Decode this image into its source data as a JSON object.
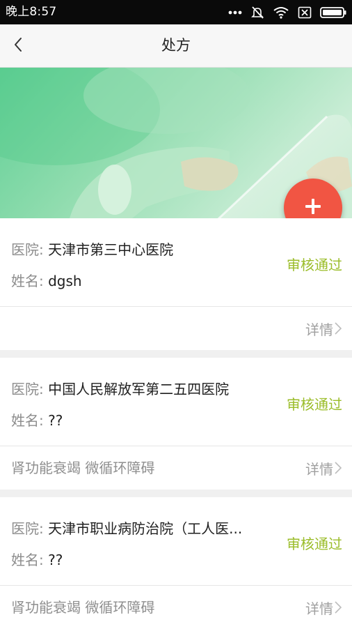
{
  "status_bar": {
    "time": "晚上8:57",
    "icons": [
      "more-dots-icon",
      "mute-bell-icon",
      "wifi-icon",
      "no-sim-icon",
      "battery-icon"
    ]
  },
  "app_bar": {
    "title": "处方",
    "back_icon": "chevron-left-icon"
  },
  "fab": {
    "icon": "plus-icon",
    "color": "#f15543"
  },
  "colors": {
    "approved": "#9bbd2a",
    "banner_green": "#6fd3a0"
  },
  "prescriptions": [
    {
      "hospital_label": "医院:",
      "hospital": "天津市第三中心医院",
      "name_label": "姓名:",
      "name": "dgsh",
      "status": "审核通过",
      "diagnosis": "",
      "detail_label": "详情"
    },
    {
      "hospital_label": "医院:",
      "hospital": "中国人民解放军第二五四医院",
      "name_label": "姓名:",
      "name": "??",
      "status": "审核通过",
      "diagnosis": "肾功能衰竭 微循环障碍",
      "detail_label": "详情"
    },
    {
      "hospital_label": "医院:",
      "hospital": "天津市职业病防治院（工人医...",
      "name_label": "姓名:",
      "name": "??",
      "status": "审核通过",
      "diagnosis": "肾功能衰竭 微循环障碍",
      "detail_label": "详情"
    }
  ]
}
